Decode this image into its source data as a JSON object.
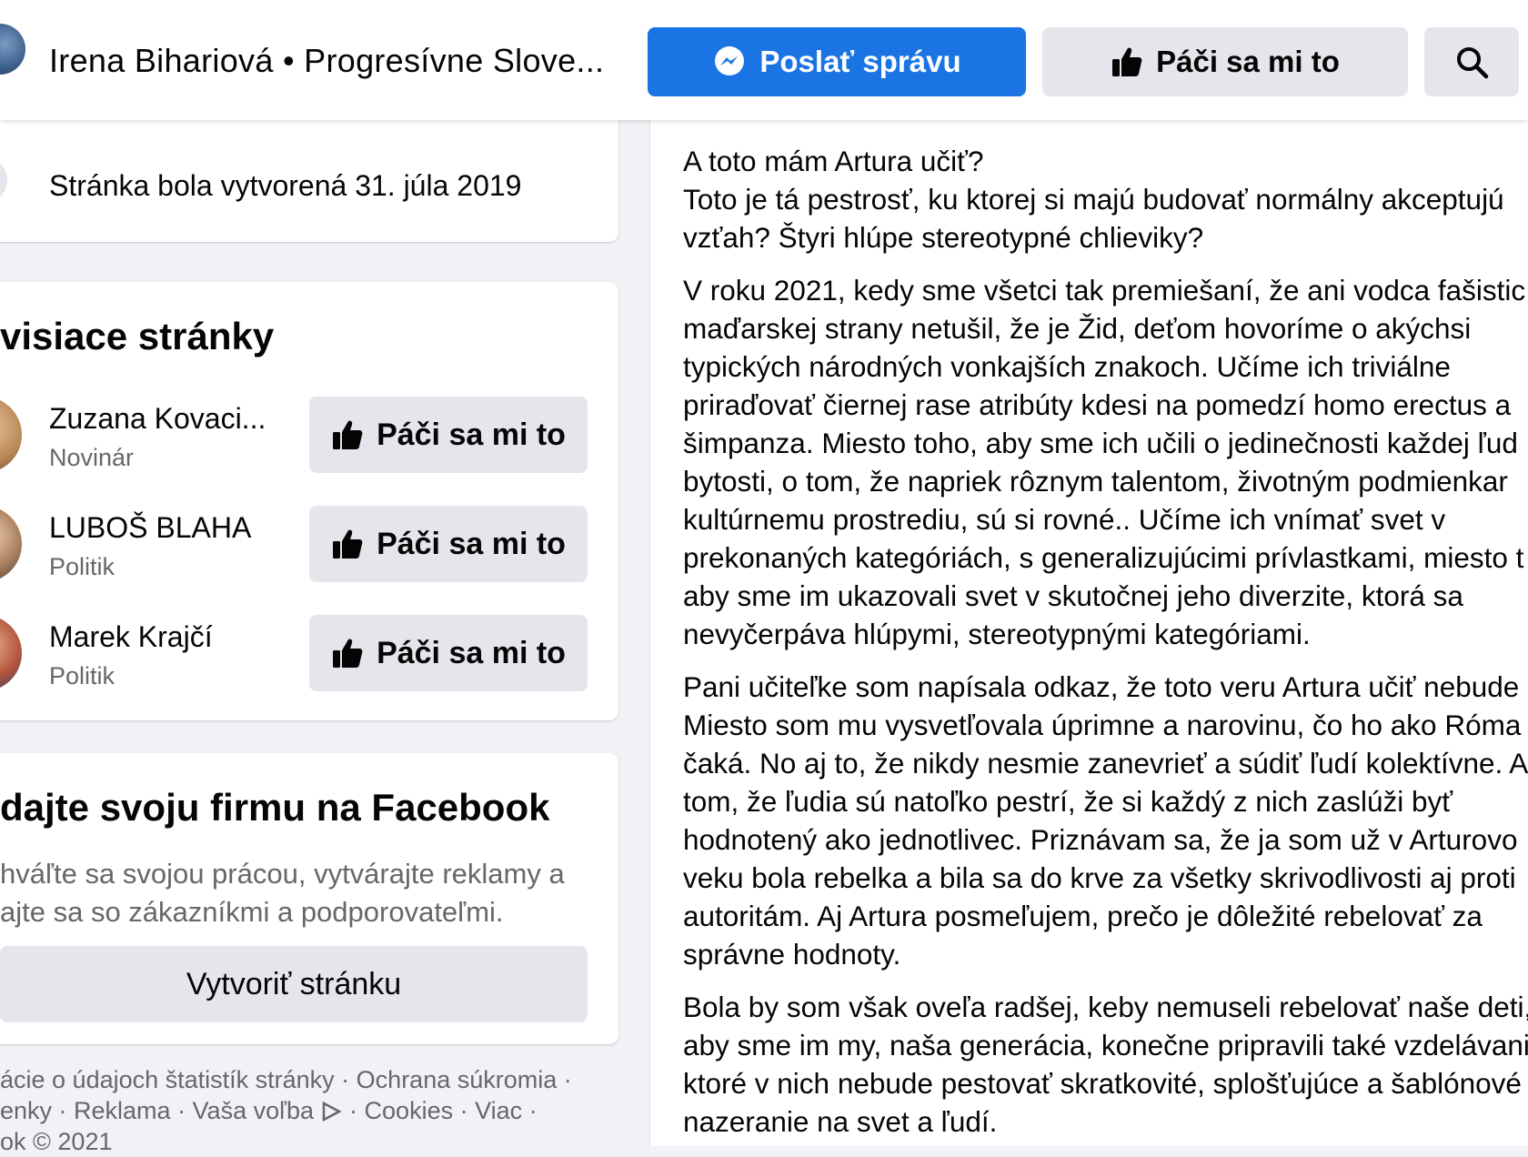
{
  "header": {
    "page_name": "Irena Bihariová • Progresívne Slove...",
    "message_button": "Poslať správu",
    "like_button": "Páči sa mi to",
    "search_icon": "search-icon",
    "colors": {
      "primary": "#1b74e4",
      "secondary": "#e4e6eb"
    }
  },
  "about": {
    "created_text": "Stránka bola vytvorená 31. júla 2019"
  },
  "related": {
    "title": "visiace stránky",
    "items": [
      {
        "name": "Zuzana Kovaci...",
        "category": "Novinár",
        "like_label": "Páči sa mi to"
      },
      {
        "name": "LUBOŠ BLAHA",
        "category": "Politik",
        "like_label": "Páči sa mi to"
      },
      {
        "name": "Marek Krajčí",
        "category": "Politik",
        "like_label": "Páči sa mi to"
      }
    ]
  },
  "promo": {
    "title": "dajte svoju firmu na Facebook",
    "line1": "hváľte sa svojou prácou, vytvárajte reklamy a",
    "line2": "ajte sa so zákazníkmi a podporovateľmi.",
    "button": "Vytvoriť stránku"
  },
  "footer": {
    "line1": "ácie o údajoch štatistík stránky · Ochrana súkromia ·",
    "line2": "enky · Reklama · Vaša voľba",
    "line2b": "· Cookies · Viac ·",
    "line3": "ok © 2021"
  },
  "post": {
    "paragraphs": [
      [
        "A toto mám Artura učiť?",
        "Toto je tá pestrosť, ku ktorej si majú budovať normálny akceptujú",
        "vzťah? Štyri hlúpe stereotypné chlieviky?"
      ],
      [
        "V roku 2021, kedy sme všetci tak premiešaní, že ani  vodca fašistic",
        "maďarskej strany netušil, že je Žid, deťom hovoríme o akýchsi",
        "typických národných vonkajších znakoch. Učíme ich triviálne",
        "priraďovať čiernej rase atribúty kdesi na pomedzí homo erectus a",
        "šimpanza. Miesto toho, aby sme ich učili o jedinečnosti každej ľud",
        "bytosti, o tom, že napriek rôznym talentom, životným podmienkar",
        "kultúrnemu prostrediu, sú si rovné.. Učíme ich vnímať svet v",
        "prekonaných kategóriách, s generalizujúcimi prívlastkami, miesto t",
        "aby sme im ukazovali svet v skutočnej jeho diverzite, ktorá sa",
        "nevyčerpáva hlúpymi, stereotypnými kategóriami."
      ],
      [
        "Pani učiteľke som napísala odkaz, že toto veru Artura učiť nebude",
        "Miesto som mu vysvetľovala úprimne a narovinu, čo ho ako Róma",
        "čaká. No aj to, že nikdy nesmie zanevrieť a súdiť ľudí kolektívne. A",
        "tom, že ľudia sú natoľko pestrí, že si každý z nich zaslúži byť",
        "hodnotený ako jednotlivec. Priznávam sa, že ja som už v Arturovo",
        "veku bola rebelka a bila sa do krve za všetky skrivodlivosti aj proti",
        "autoritám. Aj Artura posmeľujem, prečo je dôležité rebelovať za",
        "správne hodnoty."
      ],
      [
        "Bola by som však oveľa radšej, keby nemuseli rebelovať naše deti,",
        "aby sme im my, naša generácia, konečne pripravili také vzdelávani",
        "ktoré v nich nebude pestovať skratkovité, splošťujúce a šablónové",
        "nazeranie na svet a ľudí."
      ]
    ]
  }
}
